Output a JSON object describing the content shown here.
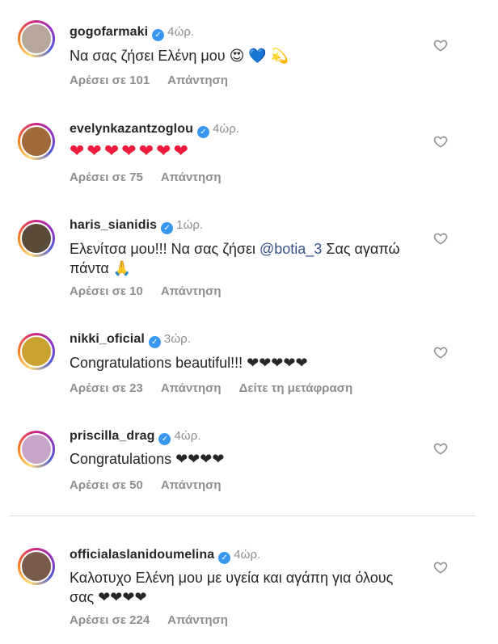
{
  "comments": [
    {
      "username": "gogofarmaki",
      "time": "4ώρ.",
      "text": "Να σας ζήσει Ελένη μου 😍 💙 💫",
      "likes": "Αρέσει σε 101",
      "reply": "Απάντηση",
      "avatar_color": "#b7a89b"
    },
    {
      "username": "evelynkazantzoglou",
      "time": "4ώρ.",
      "text": "❤❤❤❤❤❤❤",
      "likes": "Αρέσει σε 75",
      "reply": "Απάντηση",
      "avatar_color": "#a06a3a"
    },
    {
      "username": "haris_sianidis",
      "time": "1ώρ.",
      "text_before": "Ελενίτσα μου!!! Να σας ζήσει ",
      "mention": "@botia_3",
      "text_after": " Σας αγαπώ πάντα 🙏",
      "likes": "Αρέσει σε 10",
      "reply": "Απάντηση",
      "avatar_color": "#5a4a3a"
    },
    {
      "username": "nikki_oficial",
      "time": "3ώρ.",
      "text": "Congratulations beautiful!!! ❤❤❤❤❤",
      "likes": "Αρέσει σε 23",
      "reply": "Απάντηση",
      "translate": "Δείτε τη μετάφραση",
      "avatar_color": "#c9a230"
    },
    {
      "username": "priscilla_drag",
      "time": "4ώρ.",
      "text": "Congratulations ❤❤❤❤",
      "likes": "Αρέσει σε 50",
      "reply": "Απάντηση",
      "avatar_color": "#c7a6c9"
    },
    {
      "username": "officialaslanidoumelina",
      "time": "4ώρ.",
      "text": "Καλοτυχο Ελένη μου με υγεία και αγάπη για όλους σας ❤❤❤❤",
      "likes": "Αρέσει σε 224",
      "reply": "Απάντηση",
      "avatar_color": "#7a5a4a"
    }
  ],
  "icons": {
    "verified": "verified-badge-icon",
    "like": "heart-outline-icon"
  },
  "colors": {
    "verified": "#3897f0",
    "heart": "#ed1c3a",
    "secondary_text": "#8e8e8e"
  }
}
